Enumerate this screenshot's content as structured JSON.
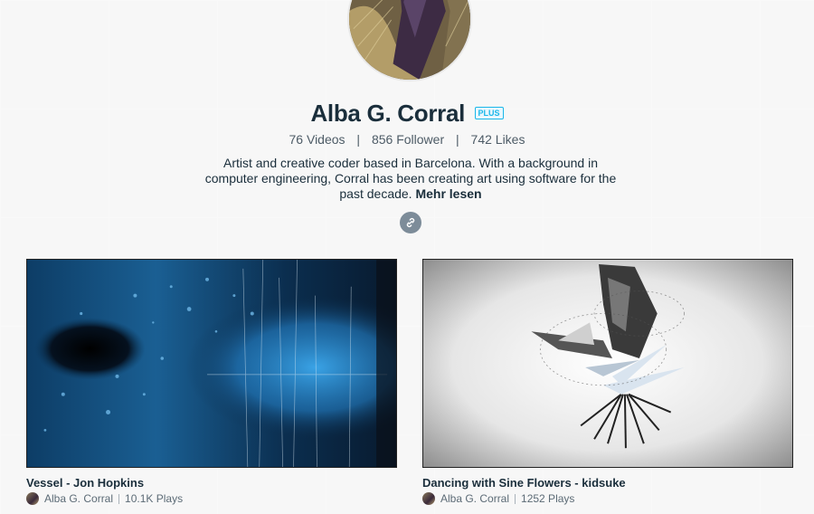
{
  "profile": {
    "name": "Alba G. Corral",
    "badge": "PLUS",
    "stats": {
      "videos": "76 Videos",
      "followers": "856 Follower",
      "likes": "742 Likes",
      "separator": "|"
    },
    "bio": "Artist and creative coder based in Barcelona. With a background in computer engineering, Corral has been creating art using software for the past decade.",
    "more_label": "Mehr lesen",
    "link_icon": "link-icon"
  },
  "videos": [
    {
      "title": "Vessel - Jon Hopkins",
      "author": "Alba G. Corral",
      "plays": "10.1K Plays"
    },
    {
      "title": "Dancing with Sine Flowers - kidsuke",
      "author": "Alba G. Corral",
      "plays": "1252 Plays"
    }
  ],
  "colors": {
    "background": "#f7f7f7",
    "text": "#1a2e3b",
    "plus_badge": "#1ab7ea",
    "link_button": "#7d8c99"
  }
}
